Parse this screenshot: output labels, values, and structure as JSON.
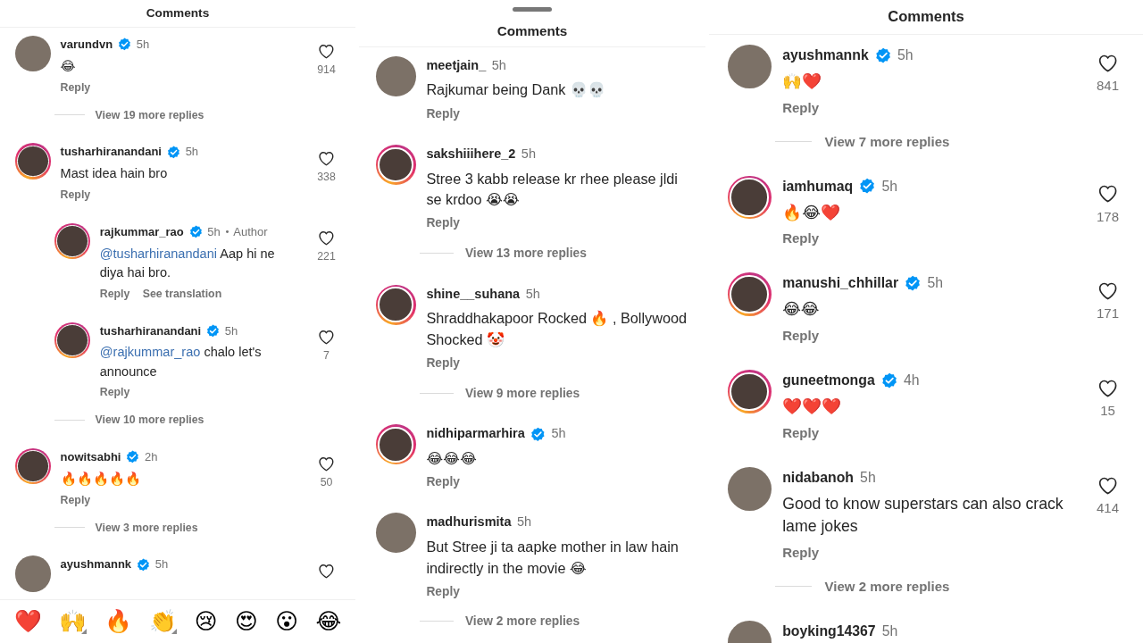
{
  "panels": [
    {
      "title": "Comments",
      "drag_handle": false,
      "comments": [
        {
          "username": "varundvn",
          "verified": true,
          "time": "5h",
          "story_ring": false,
          "text": [
            {
              "kind": "plain",
              "text": "😂"
            }
          ],
          "likes": "914",
          "actions": [
            "Reply"
          ],
          "view_replies": "View 19 more replies"
        },
        {
          "username": "tusharhiranandani",
          "verified": true,
          "time": "5h",
          "story_ring": true,
          "text": [
            {
              "kind": "plain",
              "text": "Mast idea hain bro"
            }
          ],
          "likes": "338",
          "actions": [
            "Reply"
          ],
          "replies": [
            {
              "username": "rajkummar_rao",
              "verified": true,
              "time": "5h",
              "author_tag": "Author",
              "story_ring": true,
              "text": [
                {
                  "kind": "mention",
                  "text": "@tusharhiranandani"
                },
                {
                  "kind": "plain",
                  "text": " Aap hi ne diya hai bro."
                }
              ],
              "likes": "221",
              "actions": [
                "Reply",
                "See translation"
              ]
            },
            {
              "username": "tusharhiranandani",
              "verified": true,
              "time": "5h",
              "story_ring": true,
              "text": [
                {
                  "kind": "mention",
                  "text": "@rajkummar_rao"
                },
                {
                  "kind": "plain",
                  "text": " chalo let's announce"
                }
              ],
              "likes": "7",
              "actions": [
                "Reply"
              ]
            }
          ],
          "view_replies": "View 10 more replies"
        },
        {
          "username": "nowitsabhi",
          "verified": true,
          "time": "2h",
          "story_ring": true,
          "text": [
            {
              "kind": "plain",
              "text": "🔥🔥🔥🔥🔥"
            }
          ],
          "likes": "50",
          "actions": [
            "Reply"
          ],
          "view_replies": "View 3 more replies"
        },
        {
          "username": "ayushmannk",
          "verified": true,
          "time": "5h",
          "story_ring": false,
          "like_icon": true
        }
      ],
      "emoji_bar": [
        {
          "emoji": "❤️",
          "has_variants": false
        },
        {
          "emoji": "🙌",
          "has_variants": true
        },
        {
          "emoji": "🔥",
          "has_variants": false
        },
        {
          "emoji": "👏",
          "has_variants": true
        },
        {
          "emoji": "😢",
          "has_variants": false
        },
        {
          "emoji": "😍",
          "has_variants": false
        },
        {
          "emoji": "😮",
          "has_variants": false
        },
        {
          "emoji": "😂",
          "has_variants": false
        }
      ]
    },
    {
      "title": "Comments",
      "drag_handle": true,
      "comments": [
        {
          "username": "meetjain_",
          "verified": false,
          "time": "5h",
          "story_ring": false,
          "text": [
            {
              "kind": "plain",
              "text": "Rajkumar being Dank 💀💀"
            }
          ],
          "actions": [
            "Reply"
          ]
        },
        {
          "username": "sakshiiihere_2",
          "verified": false,
          "time": "5h",
          "story_ring": true,
          "text": [
            {
              "kind": "plain",
              "text": "Stree 3 kabb release kr rhee please jldi se krdoo 😭😭"
            }
          ],
          "actions": [
            "Reply"
          ],
          "view_replies": "View 13 more replies"
        },
        {
          "username": "shine__suhana",
          "verified": false,
          "time": "5h",
          "story_ring": true,
          "text": [
            {
              "kind": "plain",
              "text": "Shraddhakapoor Rocked 🔥 , Bollywood Shocked 🤡"
            }
          ],
          "actions": [
            "Reply"
          ],
          "view_replies": "View 9 more replies"
        },
        {
          "username": "nidhiparmarhira",
          "verified": true,
          "time": "5h",
          "story_ring": true,
          "text": [
            {
              "kind": "plain",
              "text": "😂😂😂"
            }
          ],
          "actions": [
            "Reply"
          ]
        },
        {
          "username": "madhurismita",
          "verified": false,
          "time": "5h",
          "story_ring": false,
          "text": [
            {
              "kind": "plain",
              "text": "But Stree ji ta aapke mother in law hain indirectly in the movie 😂"
            }
          ],
          "actions": [
            "Reply"
          ],
          "view_replies": "View 2 more replies"
        }
      ]
    },
    {
      "title": "Comments",
      "drag_handle": false,
      "comments": [
        {
          "username": "ayushmannk",
          "verified": true,
          "time": "5h",
          "story_ring": false,
          "text": [
            {
              "kind": "plain",
              "text": "🙌❤️"
            }
          ],
          "likes": "841",
          "actions": [
            "Reply"
          ],
          "view_replies": "View 7 more replies"
        },
        {
          "username": "iamhumaq",
          "verified": true,
          "time": "5h",
          "story_ring": true,
          "text": [
            {
              "kind": "plain",
              "text": "🔥😂❤️"
            }
          ],
          "likes": "178",
          "actions": [
            "Reply"
          ]
        },
        {
          "username": "manushi_chhillar",
          "verified": true,
          "time": "5h",
          "story_ring": true,
          "text": [
            {
              "kind": "plain",
              "text": "😂😂"
            }
          ],
          "likes": "171",
          "actions": [
            "Reply"
          ]
        },
        {
          "username": "guneetmonga",
          "verified": true,
          "time": "4h",
          "story_ring": true,
          "text": [
            {
              "kind": "plain",
              "text": "❤️❤️❤️"
            }
          ],
          "likes": "15",
          "actions": [
            "Reply"
          ]
        },
        {
          "username": "nidabanoh",
          "verified": false,
          "time": "5h",
          "story_ring": false,
          "text": [
            {
              "kind": "plain",
              "text": "Good to know superstars can also crack lame jokes"
            }
          ],
          "likes": "414",
          "actions": [
            "Reply"
          ],
          "view_replies": "View 2 more replies"
        },
        {
          "username": "boyking14367",
          "verified": false,
          "time": "5h",
          "story_ring": false
        }
      ]
    }
  ]
}
